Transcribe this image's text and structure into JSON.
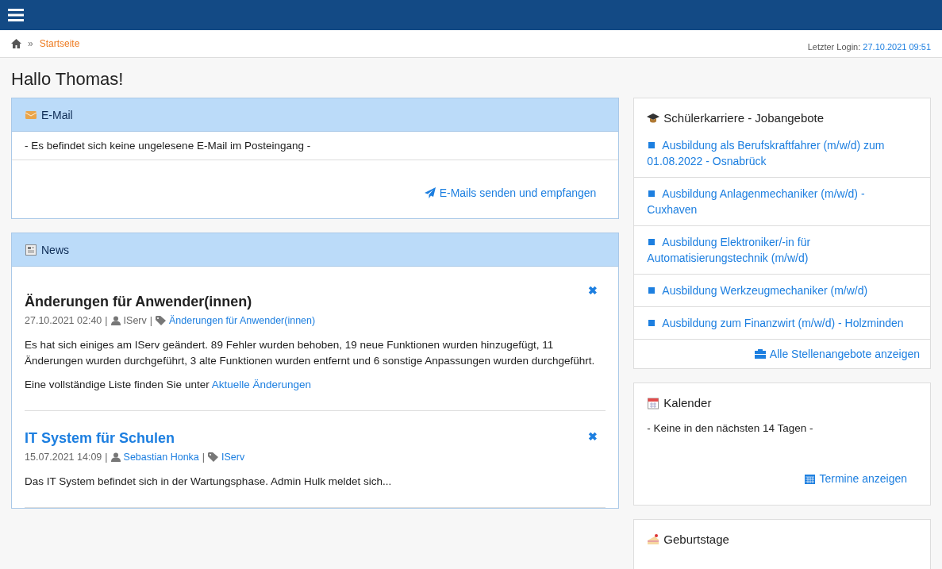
{
  "breadcrumb": {
    "separator": "»",
    "items": [
      "Startseite"
    ]
  },
  "last_login": {
    "label": "Letzter Login:",
    "value": "27.10.2021 09:51"
  },
  "greeting": "Hallo Thomas!",
  "email": {
    "title": "E-Mail",
    "message": "- Es befindet sich keine ungelesene E-Mail im Posteingang -",
    "action": "E-Mails senden und empfangen"
  },
  "news": {
    "title": "News",
    "close": "✖",
    "separator": "|",
    "items": [
      {
        "title": "Änderungen für Anwender(innen)",
        "title_link": false,
        "date": "27.10.2021 02:40",
        "author": "IServ",
        "author_link": false,
        "tag": "Änderungen für Anwender(innen)",
        "paragraphs": [
          "Es hat sich einiges am IServ geändert. 89 Fehler wurden behoben, 19 neue Funktionen wurden hinzugefügt, 11 Änderungen wurden durchgeführt, 3 alte Funktionen wurden entfernt und 6 sonstige Anpassungen wurden durchgeführt."
        ],
        "link_text": "Eine vollständige Liste finden Sie unter",
        "link": "Aktuelle Änderungen"
      },
      {
        "title": "IT System für Schulen",
        "title_link": true,
        "date": "15.07.2021 14:09",
        "author": "Sebastian Honka",
        "author_link": true,
        "tag": "IServ",
        "paragraphs": [
          "Das IT System befindet sich in der Wartungsphase. Admin Hulk meldet sich..."
        ]
      }
    ]
  },
  "jobs": {
    "title": "Schülerkarriere - Jobangebote",
    "items": [
      "Ausbildung als Berufskraftfahrer (m/w/d) zum 01.08.2022 - Osnabrück",
      "Ausbildung Anlagenmechaniker (m/w/d) - Cuxhaven",
      "Ausbildung Elektroniker/-in für Automatisierungstechnik (m/w/d)",
      "Ausbildung Werkzeugmechaniker (m/w/d)",
      "Ausbildung zum Finanzwirt (m/w/d) - Holzminden"
    ],
    "action": "Alle Stellenangebote anzeigen"
  },
  "calendar": {
    "title": "Kalender",
    "message": "- Keine in den nächsten 14 Tagen -",
    "action": "Termine anzeigen"
  },
  "birthdays": {
    "title": "Geburtstage"
  }
}
